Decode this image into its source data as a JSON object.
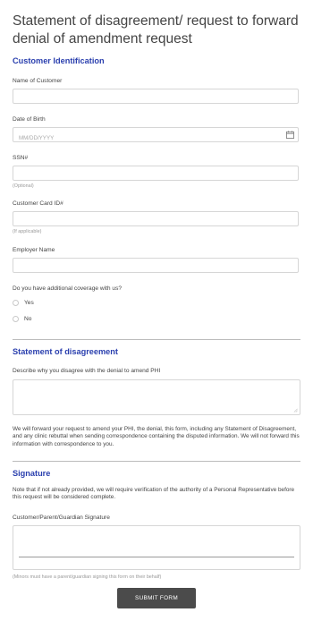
{
  "form": {
    "title": "Statement of disagreement/ request to forward denial of amendment request",
    "sections": {
      "customer_identification": "Customer Identification",
      "statement": "Statement of disagreement",
      "signature": "Signature"
    },
    "fields": {
      "name": {
        "label": "Name of Customer",
        "value": ""
      },
      "dob": {
        "label": "Date of Birth",
        "placeholder": "MM/DD/YYYY",
        "icon": "calendar-icon"
      },
      "ssn": {
        "label": "SSN#",
        "help": "(Optional)"
      },
      "card_id": {
        "label": "Customer Card ID#",
        "help": "(If applicable)"
      },
      "employer": {
        "label": "Employer Name"
      },
      "coverage": {
        "label": "Do you have additional coverage with us?",
        "options": [
          "Yes",
          "No"
        ]
      },
      "describe": {
        "label": "Describe why you disagree with the denial to amend PHI"
      },
      "signature": {
        "label": "Customer/Parent/Guardian Signature",
        "help": "(Minors must have a parent/guardian signing this form on their behalf)"
      }
    },
    "forward_notice": "We will forward your request to amend your PHI, the denial, this form, including any Statement of Disagreement, and any clinic rebuttal when sending correspondence containing the disputed information. We will not forward this information with correspondence to you.",
    "signature_notice": "Note that if not already provided, we will require verification of the authority of a Personal Representative before this request will be considered complete.",
    "submit_label": "SUBMIT FORM"
  }
}
